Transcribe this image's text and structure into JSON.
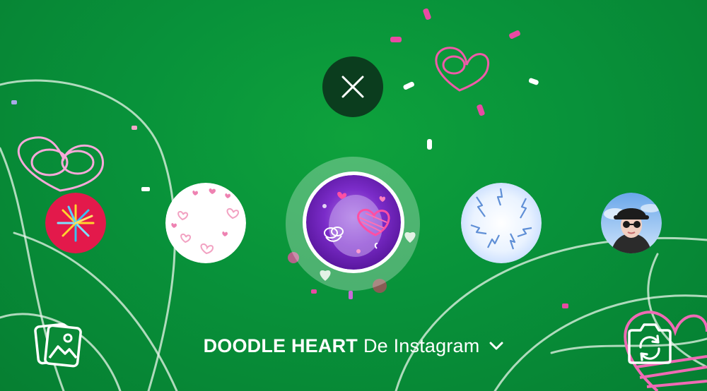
{
  "effect": {
    "name": "DOODLE HEART",
    "creator": "De Instagram"
  },
  "controls": {
    "close_icon": "close-icon",
    "gallery_icon": "gallery-icon",
    "flip_camera_icon": "flip-camera-icon",
    "dropdown_icon": "chevron-down-icon"
  },
  "effects_tray": [
    {
      "id": "fireworks",
      "icon": "fireworks-effect-thumbnail"
    },
    {
      "id": "pink-hearts",
      "icon": "pink-hearts-effect-thumbnail"
    },
    {
      "id": "doodle-heart",
      "icon": "doodle-heart-effect-thumbnail",
      "selected": true
    },
    {
      "id": "lightning",
      "icon": "lightning-effect-thumbnail"
    },
    {
      "id": "profile",
      "icon": "profile-avatar-thumbnail"
    }
  ],
  "colors": {
    "background": "#08923a",
    "close_button": "#0b3d1e",
    "doodle_pink": "#f05aa8",
    "selected_purple": "#7b2cc9"
  }
}
